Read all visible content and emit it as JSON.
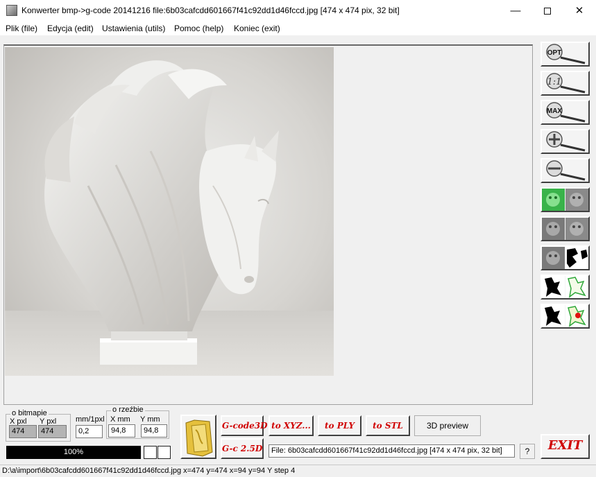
{
  "window": {
    "title": "Konwerter bmp->g-code 20141216 file:6b03cafcdd601667f41c92dd1d46fccd.jpg [474 x 474 pix, 32 bit]",
    "minimize": "—",
    "close": "✕"
  },
  "menu": [
    {
      "label": "Plik (file)"
    },
    {
      "label": "Edycja (edit)"
    },
    {
      "label": "Ustawienia (utils)"
    },
    {
      "label": "Pomoc (help)"
    },
    {
      "label": "Koniec (exit)"
    }
  ],
  "tools": {
    "opt": "OPT",
    "one_to_one": "1:1",
    "max": "MAX"
  },
  "bitmap_group": {
    "title": "o bitmapie",
    "x_label": "X pxl",
    "y_label": "Y pxl",
    "x_value": "474",
    "y_value": "474"
  },
  "scale": {
    "label": "mm/1pxl",
    "value": "0,2"
  },
  "sculpture_group": {
    "title": "o rzeźbie",
    "x_label": "X mm",
    "y_label": "Y mm",
    "x_value": "94,8",
    "y_value": "94,8"
  },
  "progress": {
    "text": "100%",
    "value": 1.0
  },
  "buttons": {
    "gcode3d": "G-code3D",
    "gc25d": "G-c 2.5D",
    "to_xyz": "to XYZ...",
    "to_ply": "to PLY",
    "to_stl": "to STL",
    "preview3d": "3D preview",
    "help": "?",
    "exit": "EXIT"
  },
  "file_info": "File: 6b03cafcdd601667f41c92dd1d46fccd.jpg [474 x 474 pix, 32 bit]",
  "status": "D:\\a\\import\\6b03cafcdd601667f41c92dd1d46fccd.jpg x=474 y=474 x=94 y=94 Y step 4",
  "colors": {
    "accent_red": "#d00000",
    "progress_bg": "#000000"
  }
}
